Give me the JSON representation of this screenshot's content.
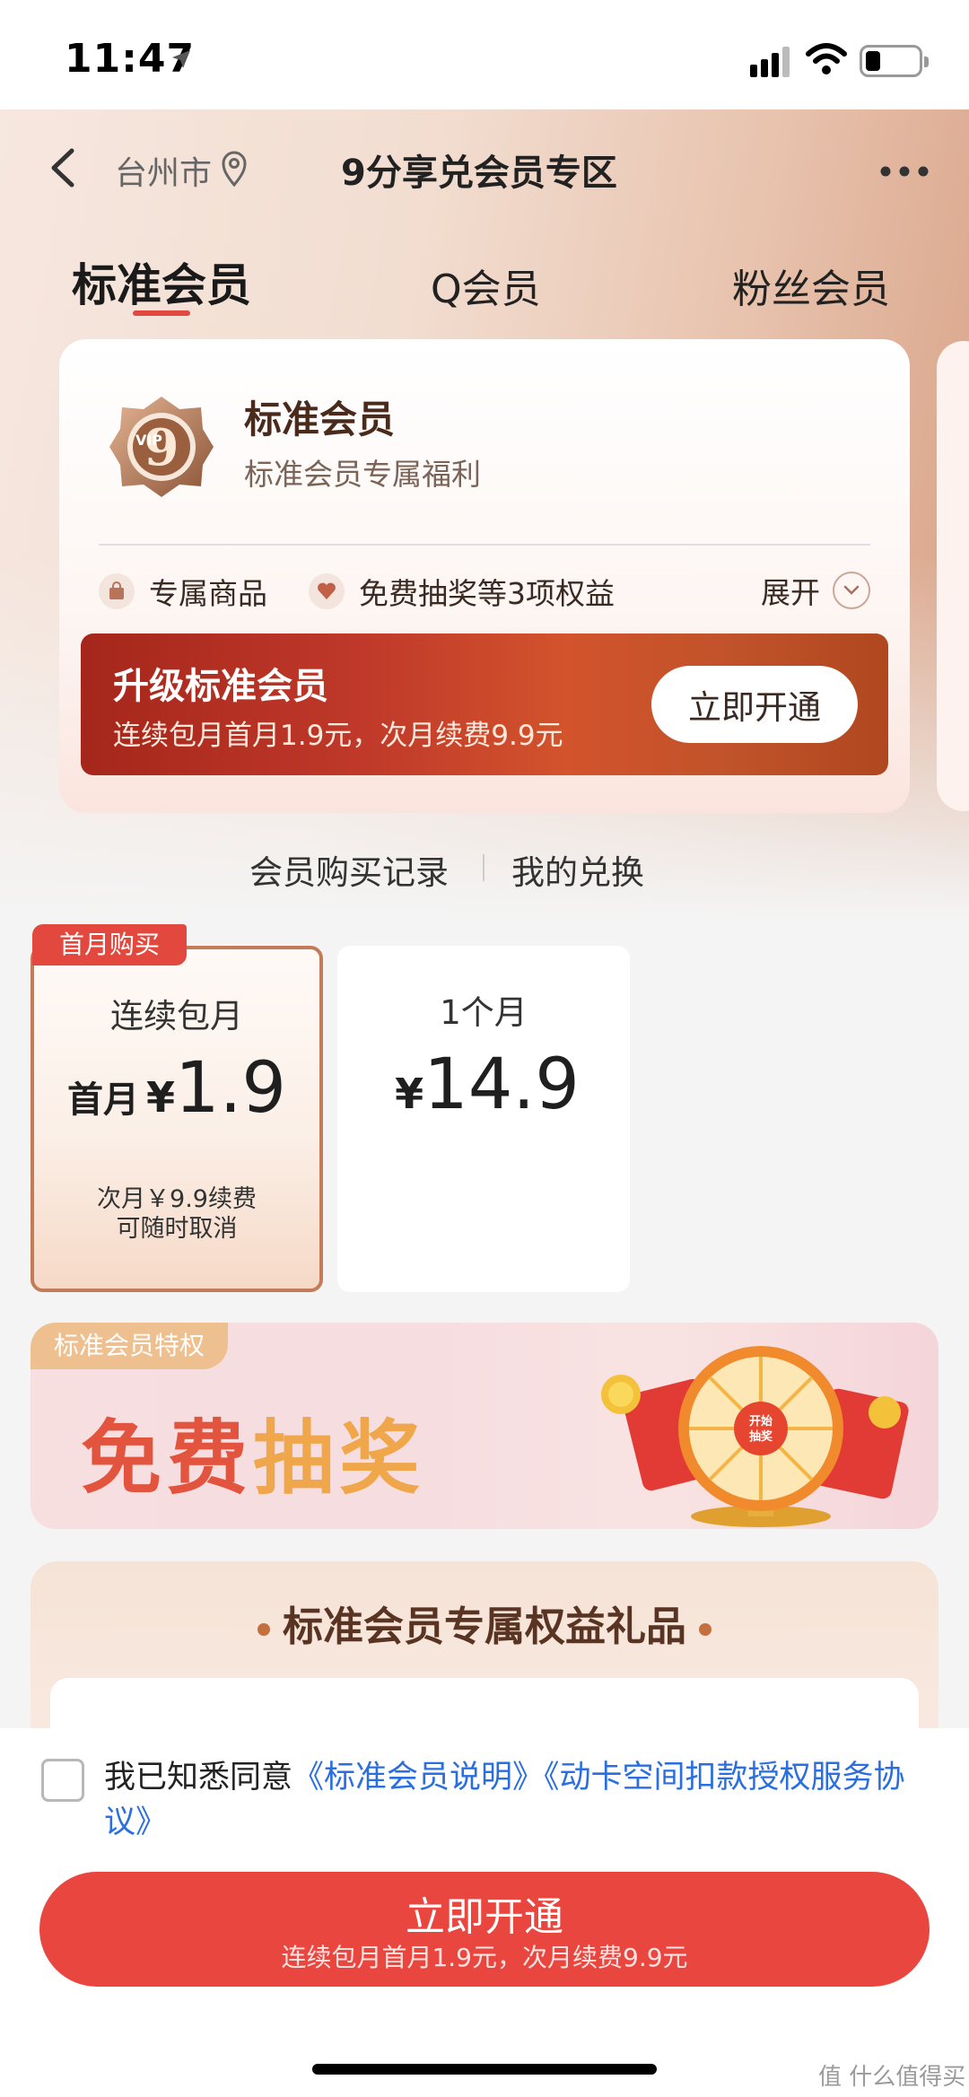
{
  "status_bar": {
    "time": "11:47"
  },
  "nav": {
    "city": "台州市",
    "title": "9分享兑会员专区"
  },
  "tabs": [
    {
      "label": "标准会员",
      "active": true
    },
    {
      "label": "Q会员",
      "active": false
    },
    {
      "label": "粉丝会员",
      "active": false
    }
  ],
  "member_card": {
    "title": "标准会员",
    "subtitle": "标准会员专属福利",
    "perks": [
      {
        "label": "专属商品",
        "icon": "shopping-bag-icon"
      },
      {
        "label": "免费抽奖等3项权益",
        "icon": "heart-icon"
      }
    ],
    "expand_label": "展开",
    "upgrade": {
      "title": "升级标准会员",
      "subtitle": "连续包月首月1.9元，次月续费9.9元",
      "button": "立即开通"
    }
  },
  "links": {
    "purchase_records": "会员购买记录",
    "my_redemptions": "我的兑换"
  },
  "plans": [
    {
      "tag": "首月购买",
      "name": "连续包月",
      "prefix": "首月",
      "currency": "¥",
      "price": "1.9",
      "note1": "次月￥9.9续费",
      "note2": "可随时取消",
      "selected": true
    },
    {
      "name": "1个月",
      "currency": "¥",
      "price": "14.9",
      "selected": false
    }
  ],
  "banner": {
    "tag": "标准会员特权",
    "text_a": "免费",
    "text_b": "抽奖",
    "wheel_label": "开始抽奖"
  },
  "gifts": {
    "title": "标准会员专属权益礼品"
  },
  "agreement": {
    "prefix": "我已知悉同意",
    "link1": "《标准会员说明》",
    "link2": "《动卡空间扣款授权服务协议》"
  },
  "cta": {
    "label": "立即开通",
    "subtitle": "连续包月首月1.9元，次月续费9.9元"
  },
  "watermark": "值 什么值得买",
  "colors": {
    "accent": "#e8463f",
    "link": "#2a6ee0",
    "gold": "#c47c58"
  }
}
